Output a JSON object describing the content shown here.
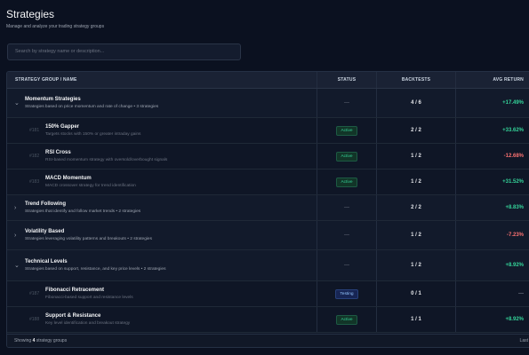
{
  "header": {
    "title": "Strategies",
    "subtitle": "Manage and analyze your trading strategy groups"
  },
  "search": {
    "placeholder": "Search by strategy name or description..."
  },
  "table": {
    "columns": [
      "STRATEGY GROUP / NAME",
      "STATUS",
      "BACKTESTS",
      "AVG RETURN"
    ],
    "rows": [
      {
        "kind": "group",
        "expanded": true,
        "name": "Momentum Strategies",
        "desc": "Strategies based on price momentum and rate of change • 3 strategies",
        "status": "—",
        "backtests": "4 / 6",
        "ret": "+17.49%",
        "sign": "pos"
      },
      {
        "kind": "child",
        "id": "#181",
        "name": "150% Gapper",
        "desc": "Targets stocks with 150% or greater intraday gains",
        "status": "Active",
        "backtests": "2 / 2",
        "ret": "+33.62%",
        "sign": "pos"
      },
      {
        "kind": "child",
        "id": "#182",
        "name": "RSI Cross",
        "desc": "RSI-based momentum strategy with oversold/overbought signals",
        "status": "Active",
        "backtests": "1 / 2",
        "ret": "-12.68%",
        "sign": "neg"
      },
      {
        "kind": "child",
        "id": "#183",
        "name": "MACD Momentum",
        "desc": "MACD crossover strategy for trend identification",
        "status": "Active",
        "backtests": "1 / 2",
        "ret": "+31.52%",
        "sign": "pos"
      },
      {
        "kind": "group",
        "expanded": false,
        "name": "Trend Following",
        "desc": "Strategies that identify and follow market trends • 2 strategies",
        "status": "—",
        "backtests": "2 / 2",
        "ret": "+8.83%",
        "sign": "pos"
      },
      {
        "kind": "group",
        "expanded": false,
        "name": "Volatility Based",
        "desc": "Strategies leveraging volatility patterns and breakouts • 2 strategies",
        "status": "—",
        "backtests": "1 / 2",
        "ret": "-7.23%",
        "sign": "neg"
      },
      {
        "kind": "group",
        "expanded": true,
        "name": "Technical Levels",
        "desc": "Strategies based on support, resistance, and key price levels • 2 strategies",
        "status": "—",
        "backtests": "1 / 2",
        "ret": "+8.92%",
        "sign": "pos"
      },
      {
        "kind": "child",
        "id": "#187",
        "name": "Fibonacci Retracement",
        "desc": "Fibonacci-based support and resistance levels",
        "status": "Testing",
        "backtests": "0 / 1",
        "ret": "—",
        "sign": "muted"
      },
      {
        "kind": "child",
        "id": "#188",
        "name": "Support & Resistance",
        "desc": "Key level identification and breakout strategy",
        "status": "Active",
        "backtests": "1 / 1",
        "ret": "+8.92%",
        "sign": "pos"
      }
    ]
  },
  "footer": {
    "prefix": "Showing",
    "count": "4",
    "suffix": "strategy groups",
    "right": "Last"
  },
  "icons": {
    "expanded": "chevron-down-icon",
    "collapsed": "chevron-right-icon"
  },
  "colors": {
    "positive": "#34d399",
    "negative": "#f87171",
    "background": "#0b1120"
  }
}
